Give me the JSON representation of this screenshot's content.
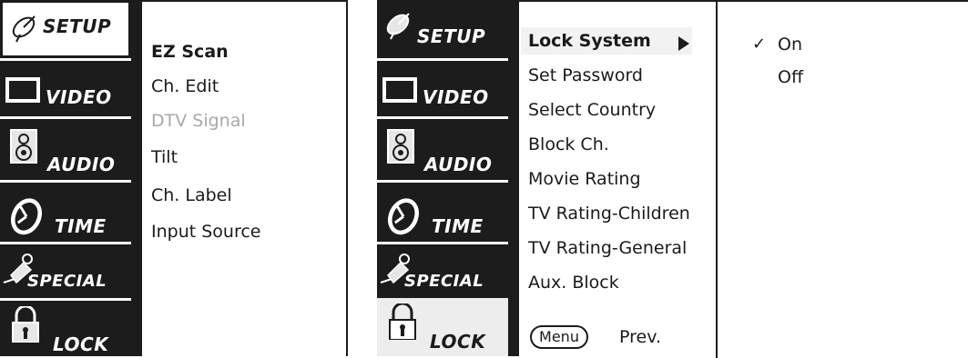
{
  "left_screen": {
    "tabs": [
      {
        "label": "SETUP",
        "icon": "satellite-dish-icon",
        "selected": true
      },
      {
        "label": "VIDEO",
        "icon": "tv-screen-icon"
      },
      {
        "label": "AUDIO",
        "icon": "speaker-icon"
      },
      {
        "label": "TIME",
        "icon": "clock-icon"
      },
      {
        "label": "SPECIAL",
        "icon": "key-tag-icon"
      },
      {
        "label": "LOCK",
        "icon": "padlock-icon"
      }
    ],
    "menu": {
      "items": [
        {
          "label": "EZ Scan",
          "state": "highlighted"
        },
        {
          "label": "Ch. Edit"
        },
        {
          "label": "DTV Signal",
          "state": "disabled"
        },
        {
          "label": "Tilt"
        },
        {
          "label": "Ch. Label"
        },
        {
          "label": "Input Source"
        }
      ]
    }
  },
  "right_screen": {
    "tabs": [
      {
        "label": "SETUP",
        "icon": "satellite-dish-icon"
      },
      {
        "label": "VIDEO",
        "icon": "tv-screen-icon"
      },
      {
        "label": "AUDIO",
        "icon": "speaker-icon"
      },
      {
        "label": "TIME",
        "icon": "clock-icon"
      },
      {
        "label": "SPECIAL",
        "icon": "key-tag-icon"
      },
      {
        "label": "LOCK",
        "icon": "padlock-icon",
        "selected": true
      }
    ],
    "menu": {
      "items": [
        {
          "label": "Lock System",
          "state": "selected"
        },
        {
          "label": "Set Password"
        },
        {
          "label": "Select Country"
        },
        {
          "label": "Block Ch."
        },
        {
          "label": "Movie Rating"
        },
        {
          "label": "TV Rating-Children"
        },
        {
          "label": "TV Rating-General"
        },
        {
          "label": "Aux. Block"
        }
      ],
      "menu_button_label": "Menu",
      "prev_label": "Prev."
    },
    "submenu": {
      "check_mark": "✓",
      "options": [
        {
          "label": "On",
          "checked": true
        },
        {
          "label": "Off",
          "checked": false
        }
      ]
    }
  },
  "colors": {
    "dark": "#1c1c1c",
    "disabled_text": "#a8a8a8",
    "selection_bg": "#f2f2f2"
  }
}
